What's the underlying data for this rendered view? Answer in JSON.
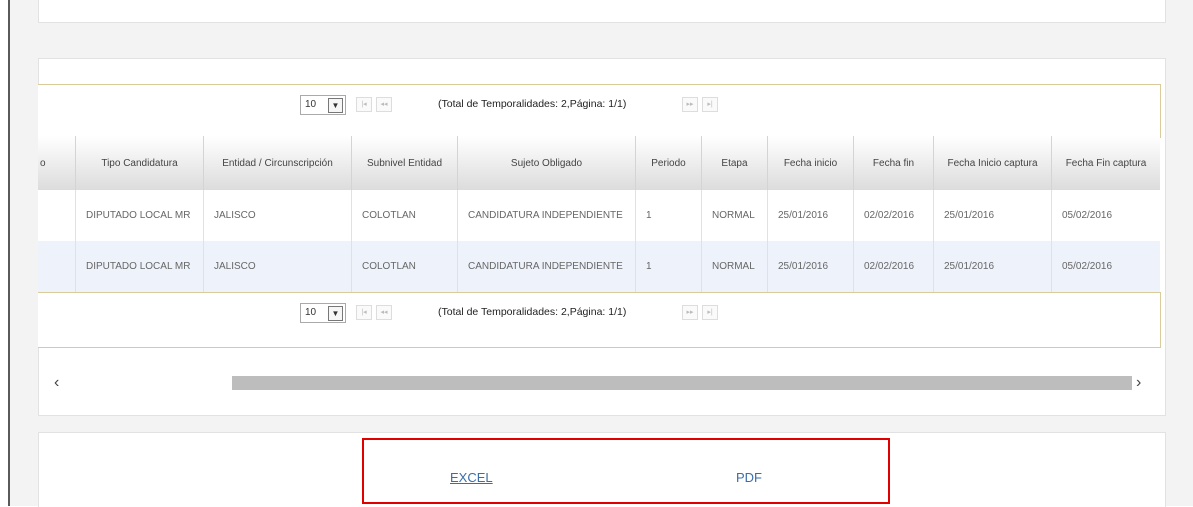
{
  "pager": {
    "page_size": "10",
    "total_text": "(Total de Temporalidades: 2,Página: 1/1)",
    "total_text_bottom": "(Total de Temporalidades: 2,Página: 1/1)"
  },
  "table": {
    "partial_header": "o",
    "headers": [
      "Tipo Candidatura",
      "Entidad / Circunscripción",
      "Subnivel Entidad",
      "Sujeto Obligado",
      "Periodo",
      "Etapa",
      "Fecha inicio",
      "Fecha fin",
      "Fecha Inicio captura",
      "Fecha Fin captura"
    ],
    "rows": [
      [
        "DIPUTADO LOCAL MR",
        "JALISCO",
        "COLOTLAN",
        "CANDIDATURA INDEPENDIENTE",
        "1",
        "NORMAL",
        "25/01/2016",
        "02/02/2016",
        "25/01/2016",
        "05/02/2016"
      ],
      [
        "DIPUTADO LOCAL MR",
        "JALISCO",
        "COLOTLAN",
        "CANDIDATURA INDEPENDIENTE",
        "1",
        "NORMAL",
        "25/01/2016",
        "02/02/2016",
        "25/01/2016",
        "05/02/2016"
      ]
    ]
  },
  "scroll": {
    "left_arrow": "‹",
    "right_arrow": "›"
  },
  "export": {
    "excel_label": "EXCEL",
    "pdf_label": "PDF"
  },
  "colors": {
    "highlight_border": "#e00000",
    "link": "#3b6ea8",
    "row_alt": "#eef3fb"
  }
}
